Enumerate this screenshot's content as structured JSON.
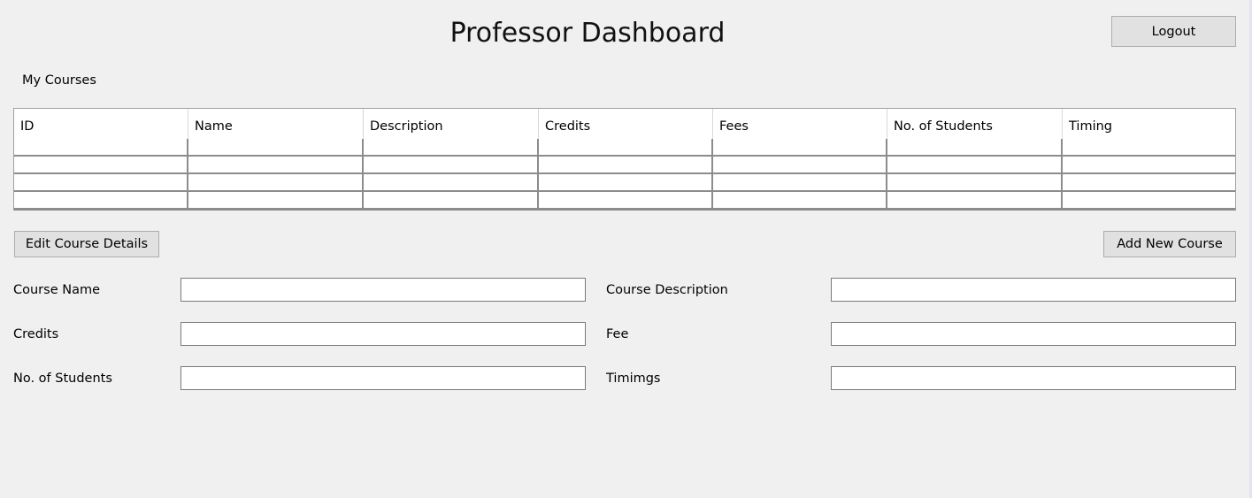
{
  "header": {
    "title": "Professor Dashboard",
    "logout_label": "Logout"
  },
  "courses": {
    "section_label": "My Courses",
    "columns": [
      "ID",
      "Name",
      "Description",
      "Credits",
      "Fees",
      "No. of Students",
      "Timing"
    ],
    "rows": [
      [
        "",
        "",
        "",
        "",
        "",
        "",
        ""
      ],
      [
        "",
        "",
        "",
        "",
        "",
        "",
        ""
      ],
      [
        "",
        "",
        "",
        "",
        "",
        "",
        ""
      ],
      [
        "",
        "",
        "",
        "",
        "",
        "",
        ""
      ]
    ]
  },
  "actions": {
    "edit_label": "Edit Course Details",
    "add_label": "Add New Course"
  },
  "form": {
    "course_name": {
      "label": "Course Name",
      "value": ""
    },
    "course_description": {
      "label": "Course Description",
      "value": ""
    },
    "credits": {
      "label": "Credits",
      "value": ""
    },
    "fee": {
      "label": "Fee",
      "value": ""
    },
    "students": {
      "label": "No. of Students",
      "value": ""
    },
    "timings": {
      "label": "Timimgs",
      "value": ""
    }
  },
  "colors": {
    "background": "#f0f0f0",
    "button": "#e1e1e1",
    "button_border": "#adadad",
    "grid_line": "#8c8c8c"
  }
}
